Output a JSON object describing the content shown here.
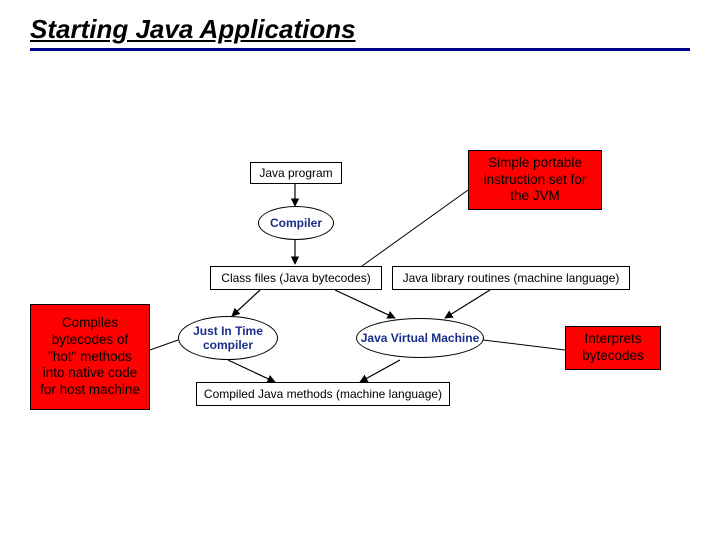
{
  "title": "Starting Java Applications",
  "nodes": {
    "java_program": "Java program",
    "compiler": "Compiler",
    "class_files": "Class files (Java bytecodes)",
    "java_lib": "Java library routines (machine language)",
    "jit": "Just In Time compiler",
    "jvm": "Java Virtual Machine",
    "compiled_methods": "Compiled Java methods (machine language)"
  },
  "callouts": {
    "simple_portable": "Simple portable instruction set for the JVM",
    "compiles_hot": "Compiles bytecodes of \"hot\" methods into native code for host machine",
    "interprets": "Interprets bytecodes"
  }
}
